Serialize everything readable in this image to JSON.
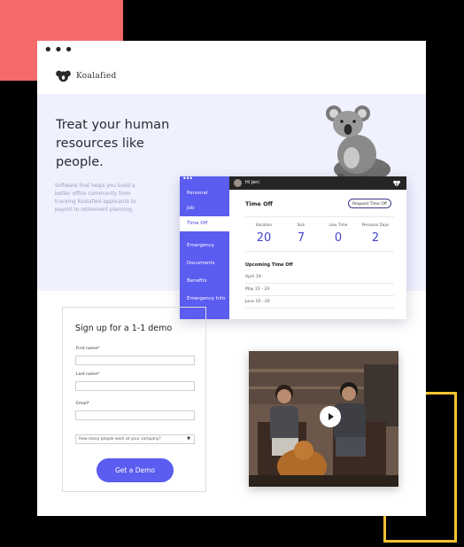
{
  "browser": {
    "dots": "•••"
  },
  "brand": {
    "name": "Koalafied"
  },
  "hero": {
    "title": "Treat your human resources like people.",
    "description": "Software that helps you build a better office community from tracking Koalafied applicants to payroll to retirement planning."
  },
  "app": {
    "user": "Hi Jeni",
    "nav": [
      "Personal",
      "Job",
      "Time Off",
      "Emergency",
      "Documents",
      "Benefits",
      "Emergency Info"
    ],
    "active_nav": "Time Off",
    "section_title": "Time Off",
    "request_button": "Request Time Off",
    "stats": [
      {
        "label": "Vacation",
        "value": "20"
      },
      {
        "label": "Sick",
        "value": "7"
      },
      {
        "label": "Lieu Time",
        "value": "0"
      },
      {
        "label": "Personal Days",
        "value": "2"
      }
    ],
    "upcoming_title": "Upcoming Time Off",
    "upcoming": [
      "April 19",
      "May 22 - 24",
      "June 10 - 20"
    ]
  },
  "form": {
    "title": "Sign up for a 1-1 demo",
    "fields": [
      {
        "label": "First name*"
      },
      {
        "label": "Last name*"
      },
      {
        "label": "Email*"
      }
    ],
    "select_value": "How many people work at your company?",
    "submit": "Get a Demo"
  },
  "colors": {
    "accent": "#5b5cf0",
    "hero_bg": "#f0f1fe",
    "coral": "#f66a6a",
    "yellow": "#f5c330"
  }
}
